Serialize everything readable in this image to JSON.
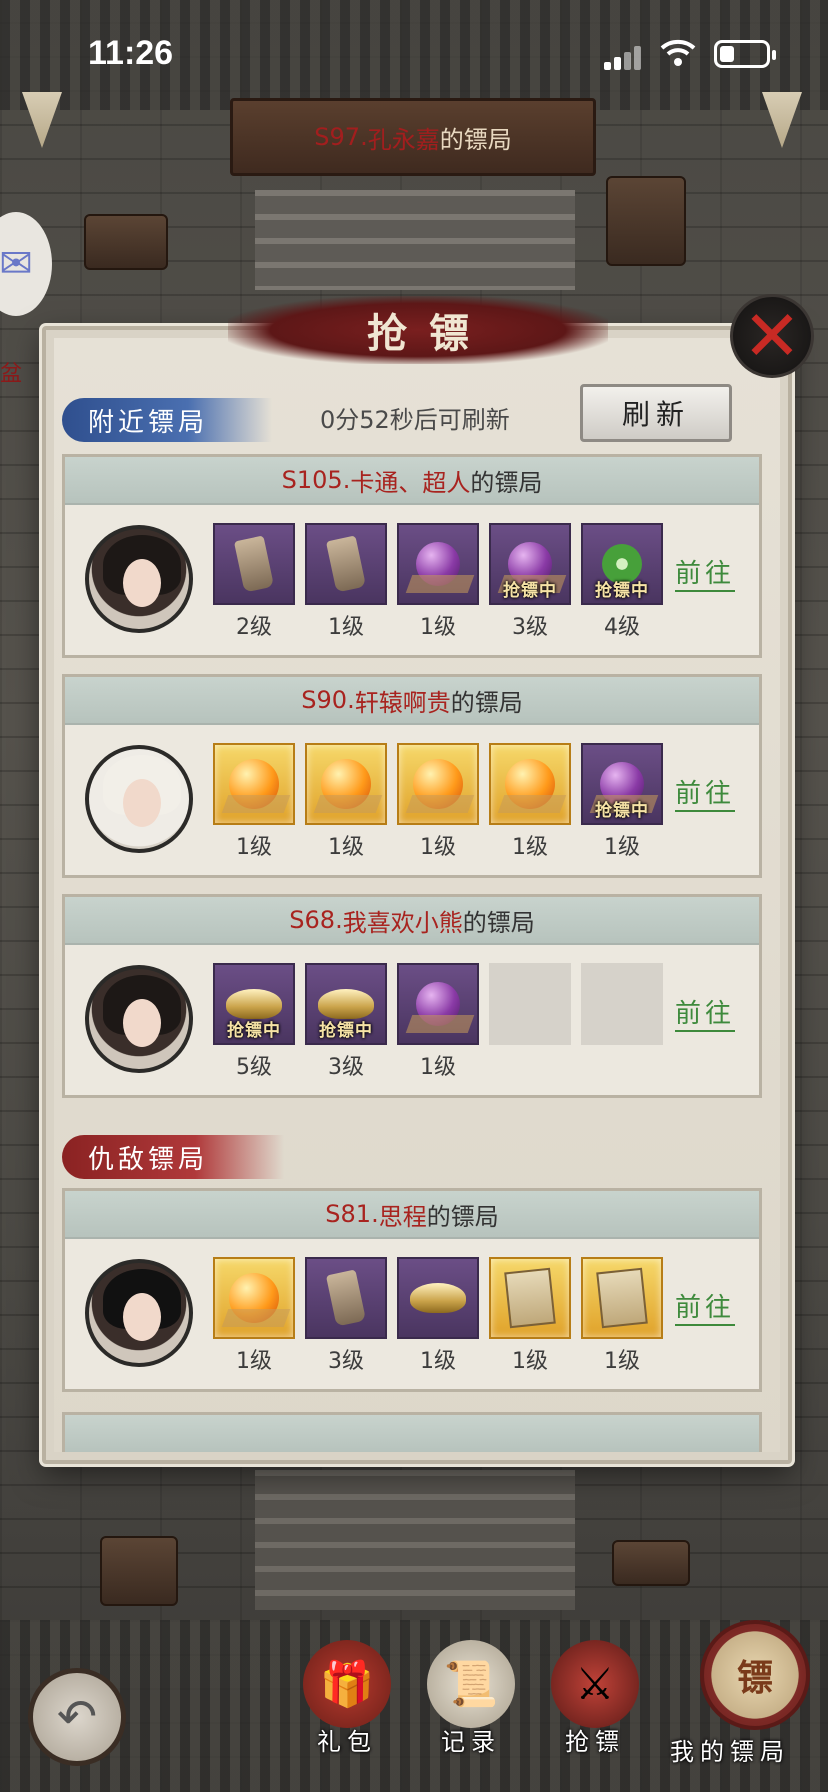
{
  "status_bar": {
    "time": "11:26"
  },
  "scene": {
    "sign_server": "S97.",
    "sign_name": "孔永嘉",
    "sign_suffix": "的镖局",
    "left_text": "盆"
  },
  "dialog": {
    "title": "抢镖",
    "close_icon": "close-x-icon",
    "nearby_tag": "附近镖局",
    "refresh_countdown": "0分52秒后可刷新",
    "refresh_label": "刷新",
    "enemy_tag": "仇敌镖局",
    "go_label": "前往",
    "robbing_badge": "抢镖中"
  },
  "nearby": [
    {
      "server": "S105.",
      "name": "卡通、超人",
      "suffix": "的镖局",
      "avatar": "female",
      "items": [
        {
          "icon": "token",
          "bg": "purple",
          "level": "2级",
          "robbing": false
        },
        {
          "icon": "token",
          "bg": "purple",
          "level": "1级",
          "robbing": false
        },
        {
          "icon": "orb",
          "bg": "purple",
          "level": "1级",
          "robbing": false
        },
        {
          "icon": "orb",
          "bg": "purple",
          "level": "3级",
          "robbing": true
        },
        {
          "icon": "jade",
          "bg": "purple",
          "level": "4级",
          "robbing": true
        }
      ]
    },
    {
      "server": "S90.",
      "name": "轩辕啊贵",
      "suffix": "的镖局",
      "avatar": "veil",
      "items": [
        {
          "icon": "amber",
          "bg": "gold",
          "level": "1级",
          "robbing": false
        },
        {
          "icon": "amber",
          "bg": "gold",
          "level": "1级",
          "robbing": false
        },
        {
          "icon": "amber",
          "bg": "gold",
          "level": "1级",
          "robbing": false
        },
        {
          "icon": "amber",
          "bg": "gold",
          "level": "1级",
          "robbing": false
        },
        {
          "icon": "orb",
          "bg": "purple",
          "level": "1级",
          "robbing": true
        }
      ]
    },
    {
      "server": "S68.",
      "name": "我喜欢小熊",
      "suffix": "的镖局",
      "avatar": "female",
      "items": [
        {
          "icon": "ingot",
          "bg": "purple",
          "level": "5级",
          "robbing": true
        },
        {
          "icon": "ingot",
          "bg": "purple",
          "level": "3级",
          "robbing": true
        },
        {
          "icon": "orb",
          "bg": "purple",
          "level": "1级",
          "robbing": false
        },
        {
          "icon": "",
          "bg": "empty",
          "level": "",
          "robbing": false
        },
        {
          "icon": "",
          "bg": "empty",
          "level": "",
          "robbing": false
        }
      ]
    }
  ],
  "enemy": [
    {
      "server": "S81.",
      "name": "思程",
      "suffix": "的镖局",
      "avatar": "male",
      "items": [
        {
          "icon": "amber",
          "bg": "gold",
          "level": "1级",
          "robbing": false
        },
        {
          "icon": "token",
          "bg": "purple",
          "level": "3级",
          "robbing": false
        },
        {
          "icon": "ingot",
          "bg": "purple",
          "level": "1级",
          "robbing": false
        },
        {
          "icon": "letter",
          "bg": "gold",
          "level": "1级",
          "robbing": false
        },
        {
          "icon": "letter",
          "bg": "gold",
          "level": "1级",
          "robbing": false
        }
      ]
    }
  ],
  "bottom_nav": {
    "back_icon": "back-arrow-icon",
    "items": [
      {
        "label": "礼包",
        "icon": "gift-box-icon"
      },
      {
        "label": "记录",
        "icon": "scroll-record-icon"
      },
      {
        "label": "抢镖",
        "icon": "crossed-weapons-icon"
      }
    ],
    "my_escort_label": "我的镖局",
    "my_escort_emblem": "镖"
  }
}
